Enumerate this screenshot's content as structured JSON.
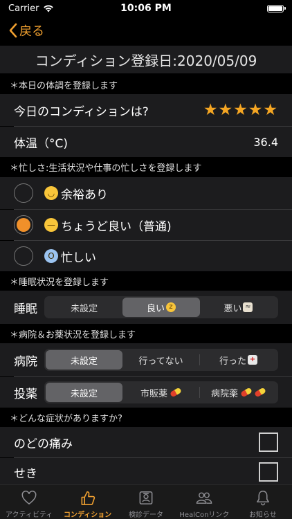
{
  "status_bar": {
    "carrier": "Carrier",
    "time": "10:06 PM",
    "battery_level": 1.0
  },
  "nav": {
    "back_label": "戻る"
  },
  "page_title": "コンディション登録日:2020/05/09",
  "sections": {
    "condition": "＊本日の体調を登録します",
    "busyness": "＊忙しさ:生活状況や仕事の忙しさを登録します",
    "sleep": "＊睡眠状況を登録します",
    "hospital": "＊病院＆お薬状況を登録します",
    "symptoms": "＊どんな症状がありますか?"
  },
  "condition": {
    "label": "今日のコンディションは?",
    "stars": "★★★★★",
    "rating": 5
  },
  "temperature": {
    "label": "体温（°C)",
    "value": "36.4"
  },
  "busyness_options": [
    {
      "label": "余裕あり",
      "emoji": "smile-emoji",
      "selected": false
    },
    {
      "label": "ちょうど良い（普通)",
      "emoji": "neutral-emoji",
      "selected": true
    },
    {
      "label": "忙しい",
      "emoji": "scream-emoji",
      "selected": false
    }
  ],
  "sleep": {
    "label": "睡眠",
    "options": [
      "未設定",
      "良い",
      "悪い"
    ],
    "selected_index": 1
  },
  "hospital": {
    "label": "病院",
    "options": [
      "未設定",
      "行ってない",
      "行った"
    ],
    "selected_index": 0
  },
  "medication": {
    "label": "投薬",
    "options": [
      "未設定",
      "市販薬",
      "病院薬"
    ],
    "selected_index": 0
  },
  "symptoms": [
    {
      "label": "のどの痛み",
      "checked": false
    },
    {
      "label": "せき",
      "checked": false
    }
  ],
  "tabs": [
    {
      "label": "アクティビティ",
      "icon": "heart-icon",
      "active": false
    },
    {
      "label": "コンディション",
      "icon": "thumbs-up-icon",
      "active": true
    },
    {
      "label": "検診データ",
      "icon": "id-card-icon",
      "active": false
    },
    {
      "label": "HealConリンク",
      "icon": "people-icon",
      "active": false
    },
    {
      "label": "お知らせ",
      "icon": "bell-icon",
      "active": false
    }
  ],
  "colors": {
    "accent": "#F0A030",
    "star": "#F5A623",
    "radio_selected": "#F0902A",
    "cell_bg": "#1C1C1E",
    "background": "#000000"
  }
}
